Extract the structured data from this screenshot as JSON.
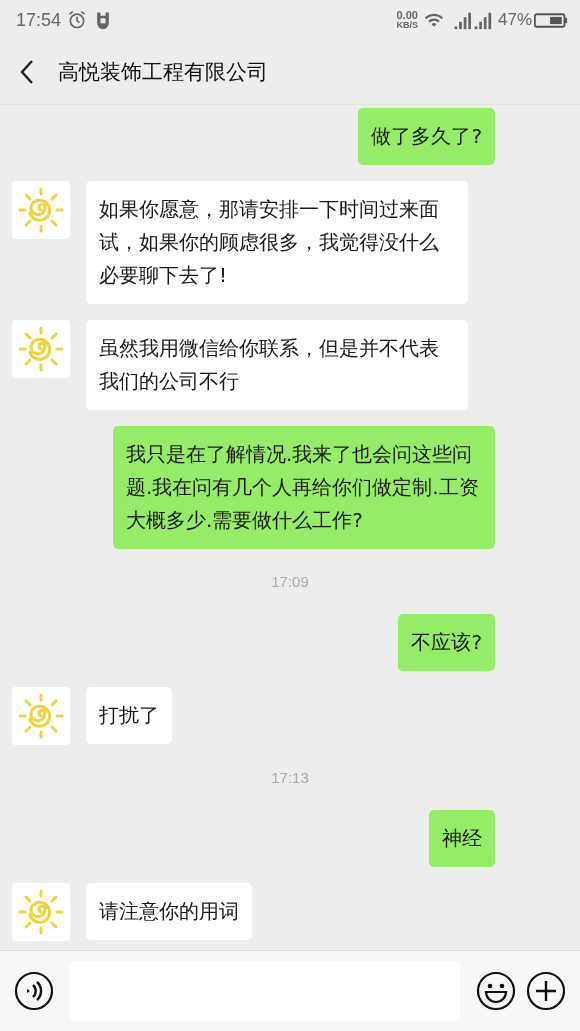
{
  "status_bar": {
    "time": "17:54",
    "net_speed": "0.00",
    "net_unit": "KB/S",
    "battery": "47%"
  },
  "header": {
    "title": "高悦装饰工程有限公司"
  },
  "messages": [
    {
      "kind": "sent",
      "text": "做了多久了?"
    },
    {
      "kind": "received",
      "text": "如果你愿意，那请安排一下时间过来面试，如果你的顾虑很多，我觉得没什么必要聊下去了!"
    },
    {
      "kind": "received",
      "text": "虽然我用微信给你联系，但是并不代表我们的公司不行"
    },
    {
      "kind": "sent",
      "text": "我只是在了解情况.我来了也会问这些问题.我在问有几个人再给你们做定制.工资大概多少.需要做什么工作?"
    },
    {
      "kind": "time",
      "text": "17:09"
    },
    {
      "kind": "sent",
      "text": "不应该?"
    },
    {
      "kind": "received",
      "text": "打扰了"
    },
    {
      "kind": "time",
      "text": "17:13"
    },
    {
      "kind": "sent",
      "text": "神经"
    },
    {
      "kind": "received",
      "text": "请注意你的用词"
    }
  ]
}
